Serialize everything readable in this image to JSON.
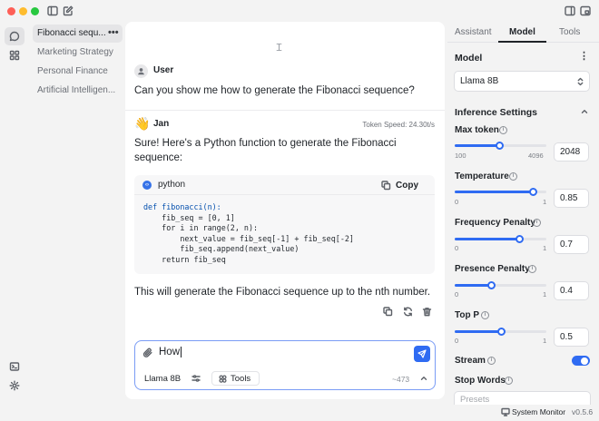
{
  "app": {
    "version": "v0.5.6",
    "system_monitor_label": "System Monitor",
    "colors": {
      "accent": "#2f6bf2",
      "traffic_red": "#fe5f57",
      "traffic_yellow": "#febc2e",
      "traffic_green": "#28c840"
    }
  },
  "threads": [
    {
      "title": "Fibonacci sequ...",
      "active": true
    },
    {
      "title": "Marketing Strategy",
      "active": false
    },
    {
      "title": "Personal Finance",
      "active": false
    },
    {
      "title": "Artificial Intelligen...",
      "active": false
    }
  ],
  "chat": {
    "user_name": "User",
    "user_message": "Can you show me how to generate the Fibonacci sequence?",
    "assistant_name": "Jan",
    "assistant_emoji": "👋",
    "token_speed": "Token Speed: 24.30t/s",
    "reply_intro_line1": "Sure! Here's a Python function to generate the Fibonacci",
    "reply_intro_line2": "sequence:",
    "code_language": "python",
    "copy_label": "Copy",
    "code_lines": [
      "def fibonacci(n):",
      "    fib_seq = [0, 1]",
      "    for i in range(2, n):",
      "        next_value = fib_seq[-1] + fib_seq[-2]",
      "        fib_seq.append(next_value)",
      "    return fib_seq"
    ],
    "reply_outro": "This will generate the Fibonacci sequence up to the nth number."
  },
  "composer": {
    "value": "How",
    "model_label": "Llama 8B",
    "tools_label": "Tools",
    "token_count": "~473"
  },
  "right_panel": {
    "tabs": [
      "Assistant",
      "Model",
      "Tools"
    ],
    "active_tab": "Model",
    "model_section_title": "Model",
    "model_selected": "Llama 8B",
    "inference_title": "Inference Settings",
    "params": {
      "max_token": {
        "label": "Max token",
        "min": "100",
        "max": "4096",
        "value": "2048",
        "fraction": 0.49
      },
      "temperature": {
        "label": "Temperature",
        "min": "0",
        "max": "1",
        "value": "0.85",
        "fraction": 0.85
      },
      "frequency_penalty": {
        "label": "Frequency Penalty",
        "min": "0",
        "max": "1",
        "value": "0.7",
        "fraction": 0.7
      },
      "presence_penalty": {
        "label": "Presence Penalty",
        "min": "0",
        "max": "1",
        "value": "0.4",
        "fraction": 0.4
      },
      "top_p": {
        "label": "Top P",
        "min": "0",
        "max": "1",
        "value": "0.5",
        "fraction": 0.5
      }
    },
    "stream_label": "Stream",
    "stream_on": true,
    "stop_words_label": "Stop Words",
    "stop_words_placeholder": "Presets"
  }
}
